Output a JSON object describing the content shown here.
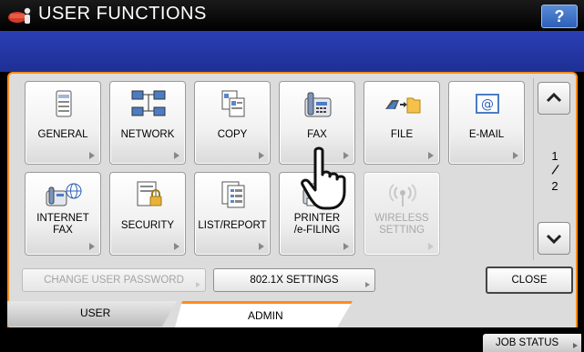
{
  "header": {
    "title": "USER FUNCTIONS",
    "help_label": "?",
    "logo_icon": "user-functions-logo-icon"
  },
  "functions": [
    {
      "label": "GENERAL",
      "icon": "printer-icon",
      "enabled": true
    },
    {
      "label": "NETWORK",
      "icon": "network-icon",
      "enabled": true
    },
    {
      "label": "COPY",
      "icon": "copy-icon",
      "enabled": true
    },
    {
      "label": "FAX",
      "icon": "fax-icon",
      "enabled": true
    },
    {
      "label": "FILE",
      "icon": "file-folder-icon",
      "enabled": true
    },
    {
      "label": "E-MAIL",
      "icon": "email-icon",
      "enabled": true
    },
    {
      "label_line1": "INTERNET",
      "label_line2": "FAX",
      "icon": "internet-fax-icon",
      "enabled": true
    },
    {
      "label": "SECURITY",
      "icon": "security-icon",
      "enabled": true
    },
    {
      "label": "LIST/REPORT",
      "icon": "list-report-icon",
      "enabled": true
    },
    {
      "label_line1": "PRINTER",
      "label_line2": "/e-FILING",
      "icon": "printer-efiling-icon",
      "enabled": true
    },
    {
      "label_line1": "WIRELESS",
      "label_line2": "SETTING",
      "icon": "wireless-icon",
      "enabled": false
    }
  ],
  "pager": {
    "current": "1",
    "separator": "/",
    "total": "2"
  },
  "lower_buttons": {
    "change_password": "CHANGE USER PASSWORD",
    "settings_8021x": "802.1X SETTINGS",
    "close": "CLOSE"
  },
  "tabs": {
    "user": "USER",
    "admin": "ADMIN",
    "active": "ADMIN"
  },
  "footer": {
    "job_status": "JOB STATUS"
  },
  "colors": {
    "accent": "#ff8c1a",
    "band": "#2a3fb5",
    "help": "#2c5fb8"
  }
}
